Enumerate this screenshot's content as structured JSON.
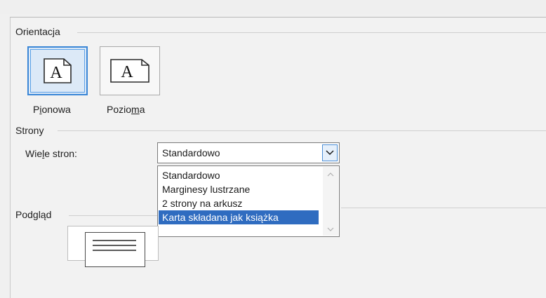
{
  "orientation": {
    "section_label": "Orientacja",
    "portrait_label_pre": "P",
    "portrait_label_u": "i",
    "portrait_label_post": "onowa",
    "landscape_label_pre": "Pozio",
    "landscape_label_u": "m",
    "landscape_label_post": "a",
    "icon_letter": "A",
    "selected": "Pionowa"
  },
  "pages": {
    "section_label": "Strony",
    "multiple_pages_label_pre": "Wie",
    "multiple_pages_label_u": "l",
    "multiple_pages_label_post": "e stron:",
    "combo_value": "Standardowo",
    "options": [
      "Standardowo",
      "Marginesy lustrzane",
      "2 strony na arkusz",
      "Karta składana jak książka"
    ],
    "highlighted_option": "Karta składana jak książka"
  },
  "preview": {
    "section_label": "Podgląd"
  },
  "colors": {
    "accent": "#3a86d6",
    "selection": "#2f6cc0"
  }
}
